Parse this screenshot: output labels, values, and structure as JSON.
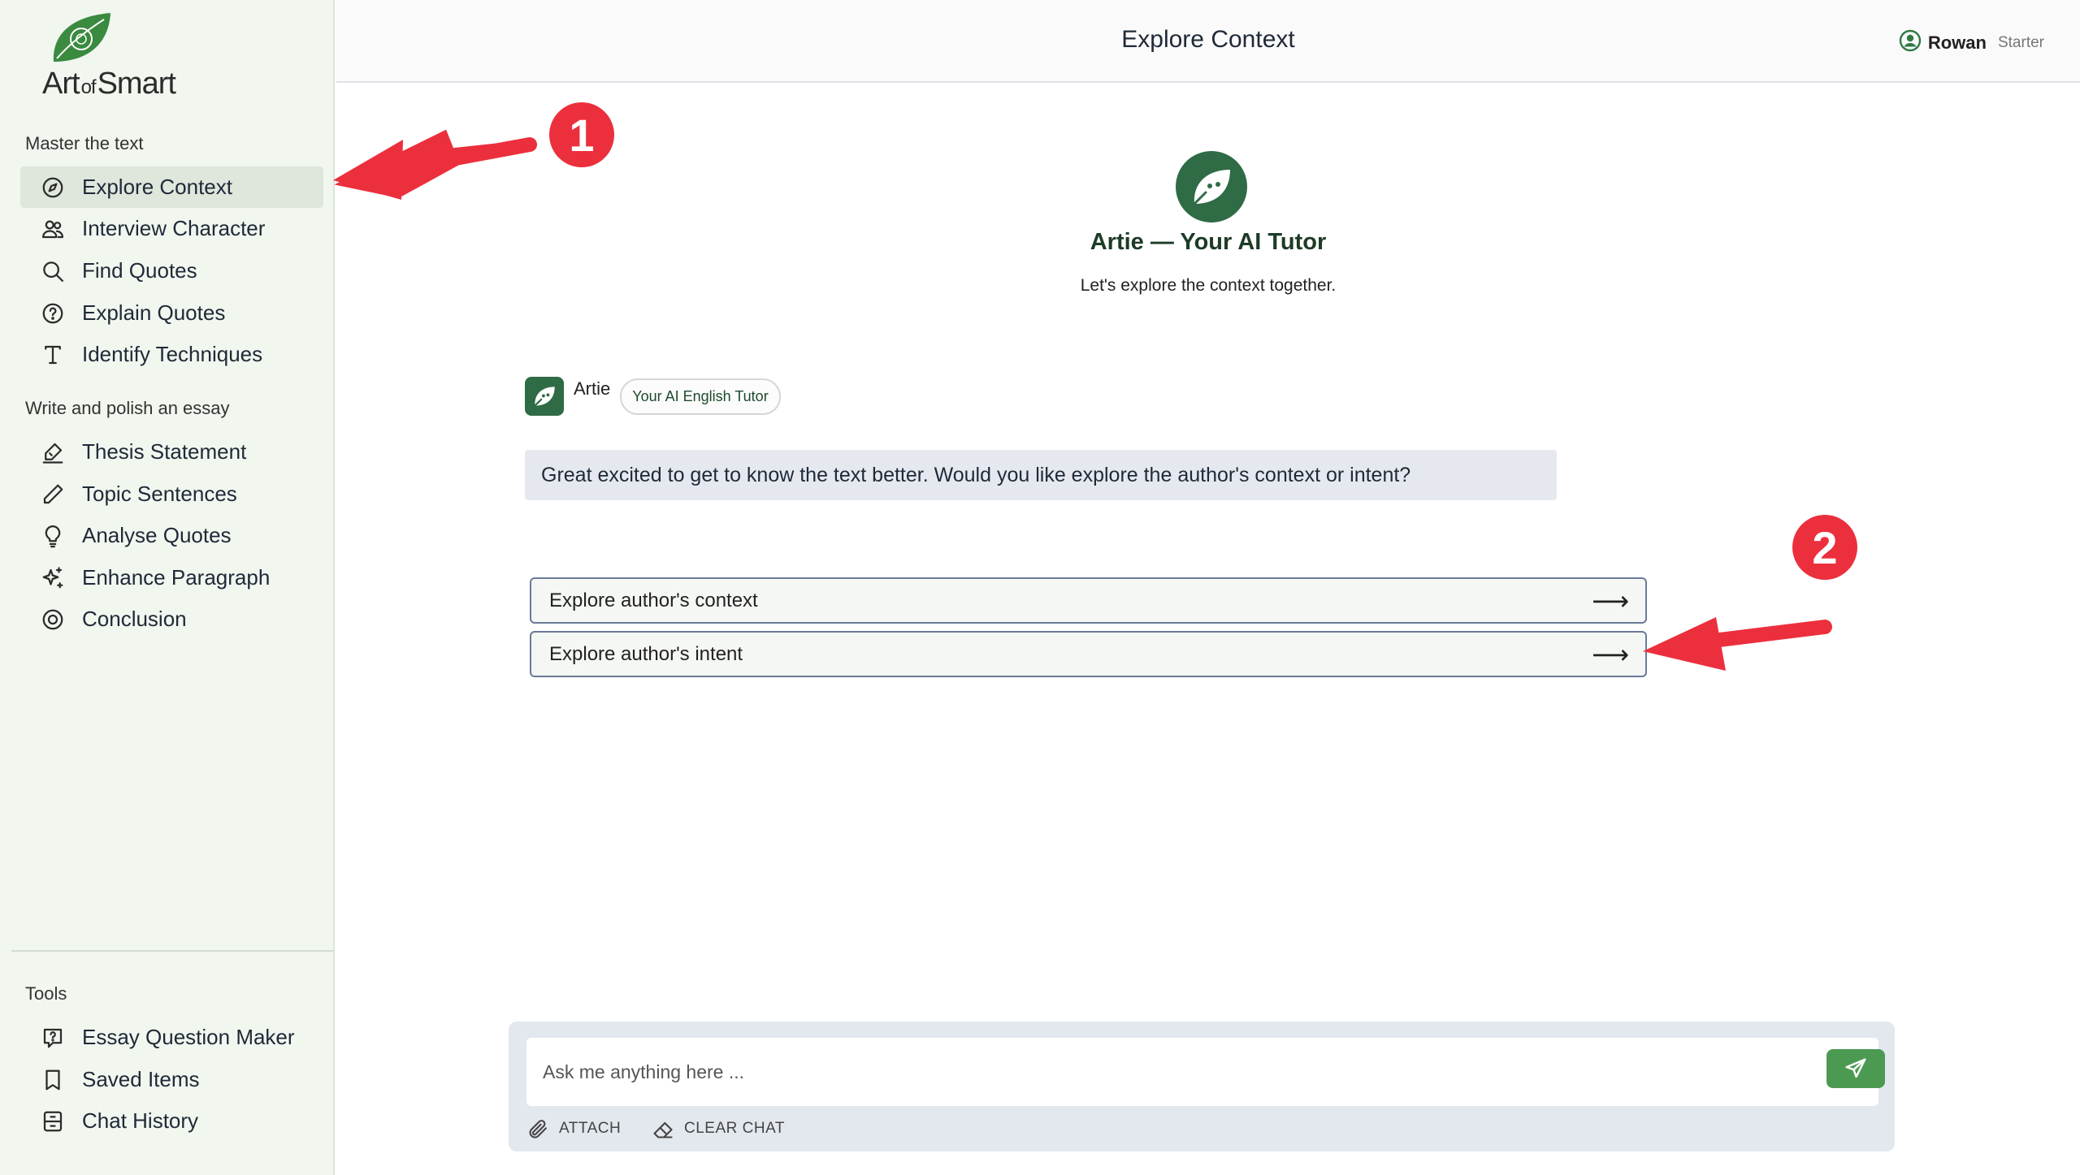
{
  "brand": {
    "name_art": "Art",
    "name_of": "of",
    "name_smart": "Smart",
    "color": "#3a8a3f"
  },
  "header": {
    "title": "Explore Context"
  },
  "user": {
    "name": "Rowan",
    "plan": "Starter"
  },
  "sidebar": {
    "sections": [
      {
        "title": "Master the text"
      },
      {
        "title": "Write and polish an essay"
      },
      {
        "title": "Tools"
      }
    ],
    "master_items": [
      {
        "label": "Explore Context",
        "icon": "compass-icon",
        "active": true
      },
      {
        "label": "Interview Character",
        "icon": "users-icon"
      },
      {
        "label": "Find Quotes",
        "icon": "search-icon"
      },
      {
        "label": "Explain Quotes",
        "icon": "help-circle-icon"
      },
      {
        "label": "Identify Techniques",
        "icon": "type-icon"
      }
    ],
    "essay_items": [
      {
        "label": "Thesis Statement",
        "icon": "signature-icon"
      },
      {
        "label": "Topic Sentences",
        "icon": "pencil-icon"
      },
      {
        "label": "Analyse Quotes",
        "icon": "lightbulb-icon"
      },
      {
        "label": "Enhance Paragraph",
        "icon": "sparkles-icon"
      },
      {
        "label": "Conclusion",
        "icon": "target-icon"
      }
    ],
    "tool_items": [
      {
        "label": "Essay Question Maker",
        "icon": "question-message-icon"
      },
      {
        "label": "Saved Items",
        "icon": "bookmark-icon"
      },
      {
        "label": "Chat History",
        "icon": "archive-icon"
      }
    ]
  },
  "intro": {
    "title": "Artie — Your AI Tutor",
    "subtitle": "Let's explore the context together."
  },
  "message": {
    "sender": "Artie",
    "badge": "Your AI English Tutor",
    "text": "Great excited to get to know the text better. Would you like explore the author's context or intent?"
  },
  "options": [
    {
      "label": "Explore author's context",
      "arrow": "⟶"
    },
    {
      "label": "Explore author's intent",
      "arrow": "⟶"
    }
  ],
  "annotations": [
    {
      "number": "1"
    },
    {
      "number": "2"
    }
  ],
  "composer": {
    "placeholder": "Ask me anything here ...",
    "attach_label": "ATTACH",
    "clear_label": "CLEAR CHAT"
  },
  "colors": {
    "accent": "#2f6b45",
    "annotation": "#ec2f3d",
    "send": "#4c9a52"
  }
}
